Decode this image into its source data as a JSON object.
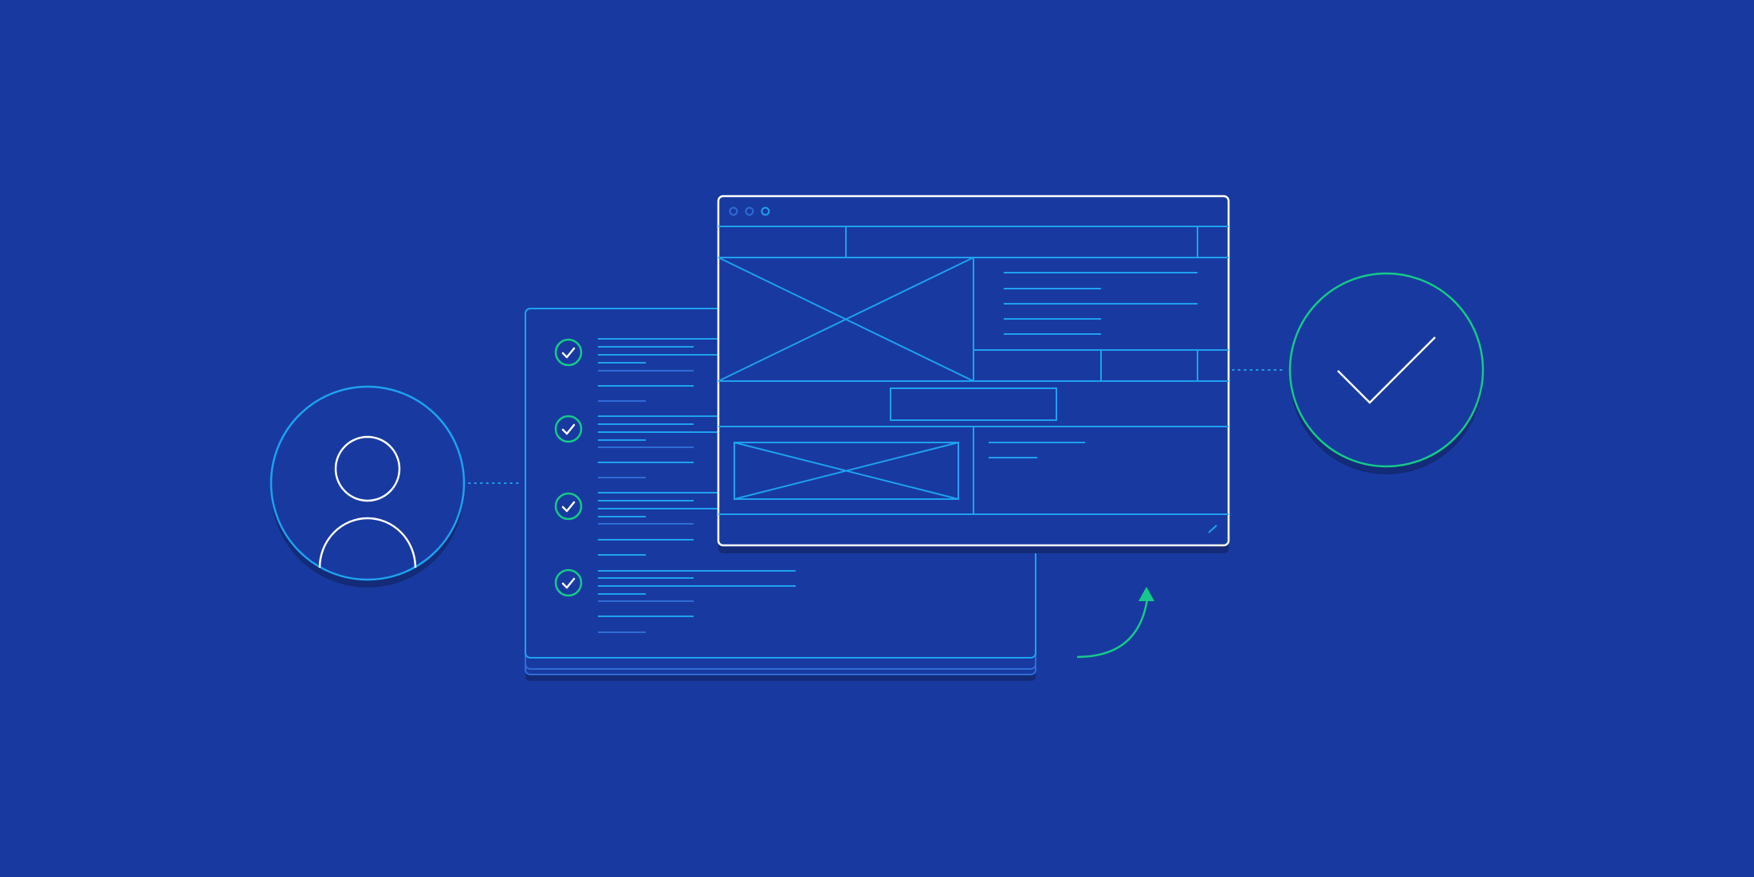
{
  "colors": {
    "background": "#183aa0",
    "shadow": "#132b78",
    "accent_blue": "#1fa1f0",
    "dim_blue": "#2f6cd6",
    "white": "#ffffff",
    "green": "#16c98a"
  },
  "illustration": {
    "user_icon": "user-avatar-icon",
    "status_icon": "checkmark-icon",
    "checklist_count": 4,
    "window_controls": 3,
    "progress_arrow_icon": "curved-arrow-up-icon"
  }
}
